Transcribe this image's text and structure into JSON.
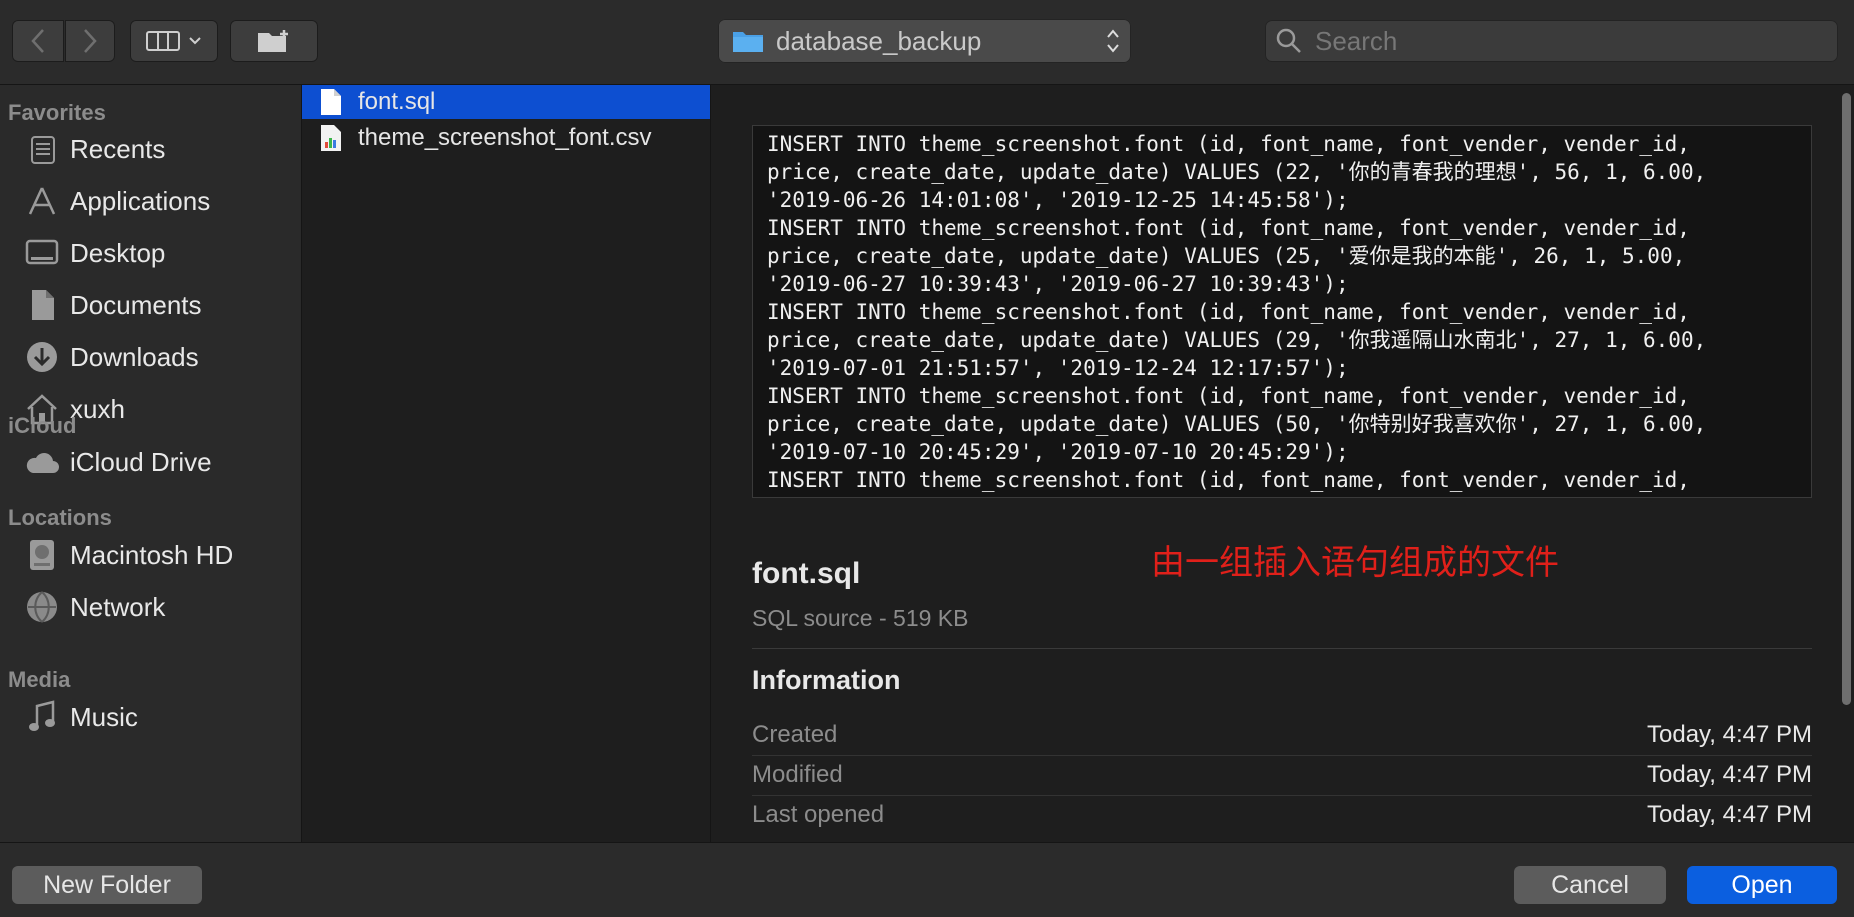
{
  "toolbar": {
    "path": "database_backup",
    "search_placeholder": "Search"
  },
  "sidebar": {
    "sections": [
      {
        "heading": "Favorites"
      },
      {
        "heading": "iCloud"
      },
      {
        "heading": "Locations"
      },
      {
        "heading": "Media"
      }
    ],
    "items": [
      {
        "label": "Recents",
        "icon": "recents-icon"
      },
      {
        "label": "Applications",
        "icon": "applications-icon"
      },
      {
        "label": "Desktop",
        "icon": "desktop-icon"
      },
      {
        "label": "Documents",
        "icon": "documents-icon"
      },
      {
        "label": "Downloads",
        "icon": "downloads-icon"
      },
      {
        "label": "xuxh",
        "icon": "home-icon"
      },
      {
        "label": "iCloud Drive",
        "icon": "cloud-icon"
      },
      {
        "label": "Macintosh HD",
        "icon": "disk-icon"
      },
      {
        "label": "Network",
        "icon": "network-icon"
      },
      {
        "label": "Music",
        "icon": "music-icon"
      }
    ]
  },
  "files": [
    {
      "name": "font.sql",
      "selected": true
    },
    {
      "name": "theme_screenshot_font.csv",
      "selected": false
    }
  ],
  "preview": {
    "code_lines": [
      "INSERT INTO theme_screenshot.font (id, font_name, font_vender, vender_id,",
      "price, create_date, update_date) VALUES (22, '你的青春我的理想', 56, 1, 6.00,",
      "'2019-06-26 14:01:08', '2019-12-25 14:45:58');",
      "INSERT INTO theme_screenshot.font (id, font_name, font_vender, vender_id,",
      "price, create_date, update_date) VALUES (25, '爱你是我的本能', 26, 1, 5.00,",
      "'2019-06-27 10:39:43', '2019-06-27 10:39:43');",
      "INSERT INTO theme_screenshot.font (id, font_name, font_vender, vender_id,",
      "price, create_date, update_date) VALUES (29, '你我遥隔山水南北', 27, 1, 6.00,",
      "'2019-07-01 21:51:57', '2019-12-24 12:17:57');",
      "INSERT INTO theme_screenshot.font (id, font_name, font_vender, vender_id,",
      "price, create_date, update_date) VALUES (50, '你特别好我喜欢你', 27, 1, 6.00,",
      "'2019-07-10 20:45:29', '2019-07-10 20:45:29');",
      "INSERT INTO theme_screenshot.font (id, font_name, font_vender, vender_id,"
    ],
    "annotation": "由一组插入语句组成的文件",
    "file_name": "font.sql",
    "file_kind": "SQL source - 519 KB",
    "info_heading": "Information",
    "info": [
      {
        "label": "Created",
        "value": "Today, 4:47 PM"
      },
      {
        "label": "Modified",
        "value": "Today, 4:47 PM"
      },
      {
        "label": "Last opened",
        "value": "Today, 4:47 PM"
      }
    ]
  },
  "footer": {
    "new_folder": "New Folder",
    "cancel": "Cancel",
    "open": "Open"
  }
}
